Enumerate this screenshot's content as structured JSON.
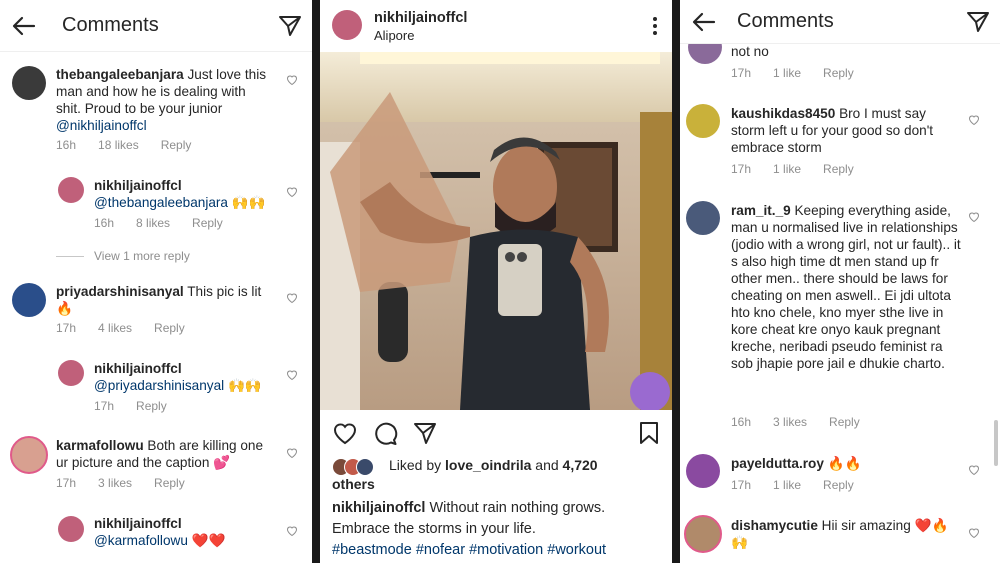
{
  "left": {
    "title": "Comments",
    "comments": [
      {
        "user": "thebangaleebanjara",
        "text": "Just love this man and how he is dealing with shit. Proud to be your junior",
        "mention": "@nikhiljainoffcl",
        "time": "16h",
        "likes": "18 likes",
        "reply": "Reply",
        "avatar": "#3a3a3a"
      },
      {
        "user": "nikhiljainoffcl",
        "text": "",
        "mention": "@thebangaleebanjara",
        "emoji": "🙌🙌",
        "time": "16h",
        "likes": "8 likes",
        "reply": "Reply",
        "avatar": "#c0607a"
      },
      {
        "user": "priyadarshinisanyal",
        "text": "This pic is lit",
        "emoji": "🔥",
        "time": "17h",
        "likes": "4 likes",
        "reply": "Reply",
        "avatar": "#2a4e8a"
      },
      {
        "user": "nikhiljainoffcl",
        "text": "",
        "mention": "@priyadarshinisanyal",
        "emoji": "🙌🙌",
        "time": "17h",
        "likes": "",
        "reply": "Reply",
        "avatar": "#c0607a"
      },
      {
        "user": "karmafollowu",
        "text": "Both are killing one ur picture and the caption",
        "emoji": "💕",
        "time": "17h",
        "likes": "3 likes",
        "reply": "Reply",
        "avatar": "#d8a090"
      },
      {
        "user": "nikhiljainoffcl",
        "text": "",
        "mention": "@karmafollowu",
        "emoji": "❤️❤️",
        "time": "",
        "likes": "",
        "reply": "",
        "avatar": "#c0607a"
      }
    ],
    "view_more": "View 1 more reply"
  },
  "middle": {
    "username": "nikhiljainoffcl",
    "location": "Alipore",
    "liked_prefix": "Liked by",
    "liked_user": "love_oindrila",
    "liked_and": "and",
    "liked_count": "4,720",
    "liked_others": "others",
    "caption_user": "nikhiljainoffcl",
    "caption_text": "Without rain nothing grows. Embrace the storms in your life.",
    "hashtags": [
      "#beastmode",
      "#nofear",
      "#motivation",
      "#workout"
    ]
  },
  "right": {
    "title": "Comments",
    "top_partial": "not no",
    "top_meta": {
      "time": "17h",
      "likes": "1 like",
      "reply": "Reply"
    },
    "comments": [
      {
        "user": "kaushikdas8450",
        "text": "Bro I must say storm left u for your good so don't embrace storm",
        "time": "17h",
        "likes": "1 like",
        "reply": "Reply",
        "avatar": "#c9b13a"
      },
      {
        "user": "ram_it._9",
        "text": "Keeping everything aside, man u normalised live in relationships (jodio with a wrong girl, not ur fault).. it s also high time dt men stand up fr other men.. there should be laws for cheating on men aswell.. Ei jdi ultota hto kno chele, kno myer sthe live in kore cheat kre onyo kauk pregnant kreche, neribadi pseudo feminist ra sob jhapie pore jail e dhukie charto.",
        "time": "16h",
        "likes": "3 likes",
        "reply": "Reply",
        "avatar": "#4a5a7a"
      },
      {
        "user": "payeldutta.roy",
        "text": "🔥🔥",
        "time": "17h",
        "likes": "1 like",
        "reply": "Reply",
        "avatar": "#8a4aa0"
      },
      {
        "user": "dishamycutie",
        "text": "Hii sir amazing ❤️🔥🙌",
        "time": "",
        "likes": "",
        "reply": "",
        "avatar": "#b08a6a"
      }
    ]
  }
}
